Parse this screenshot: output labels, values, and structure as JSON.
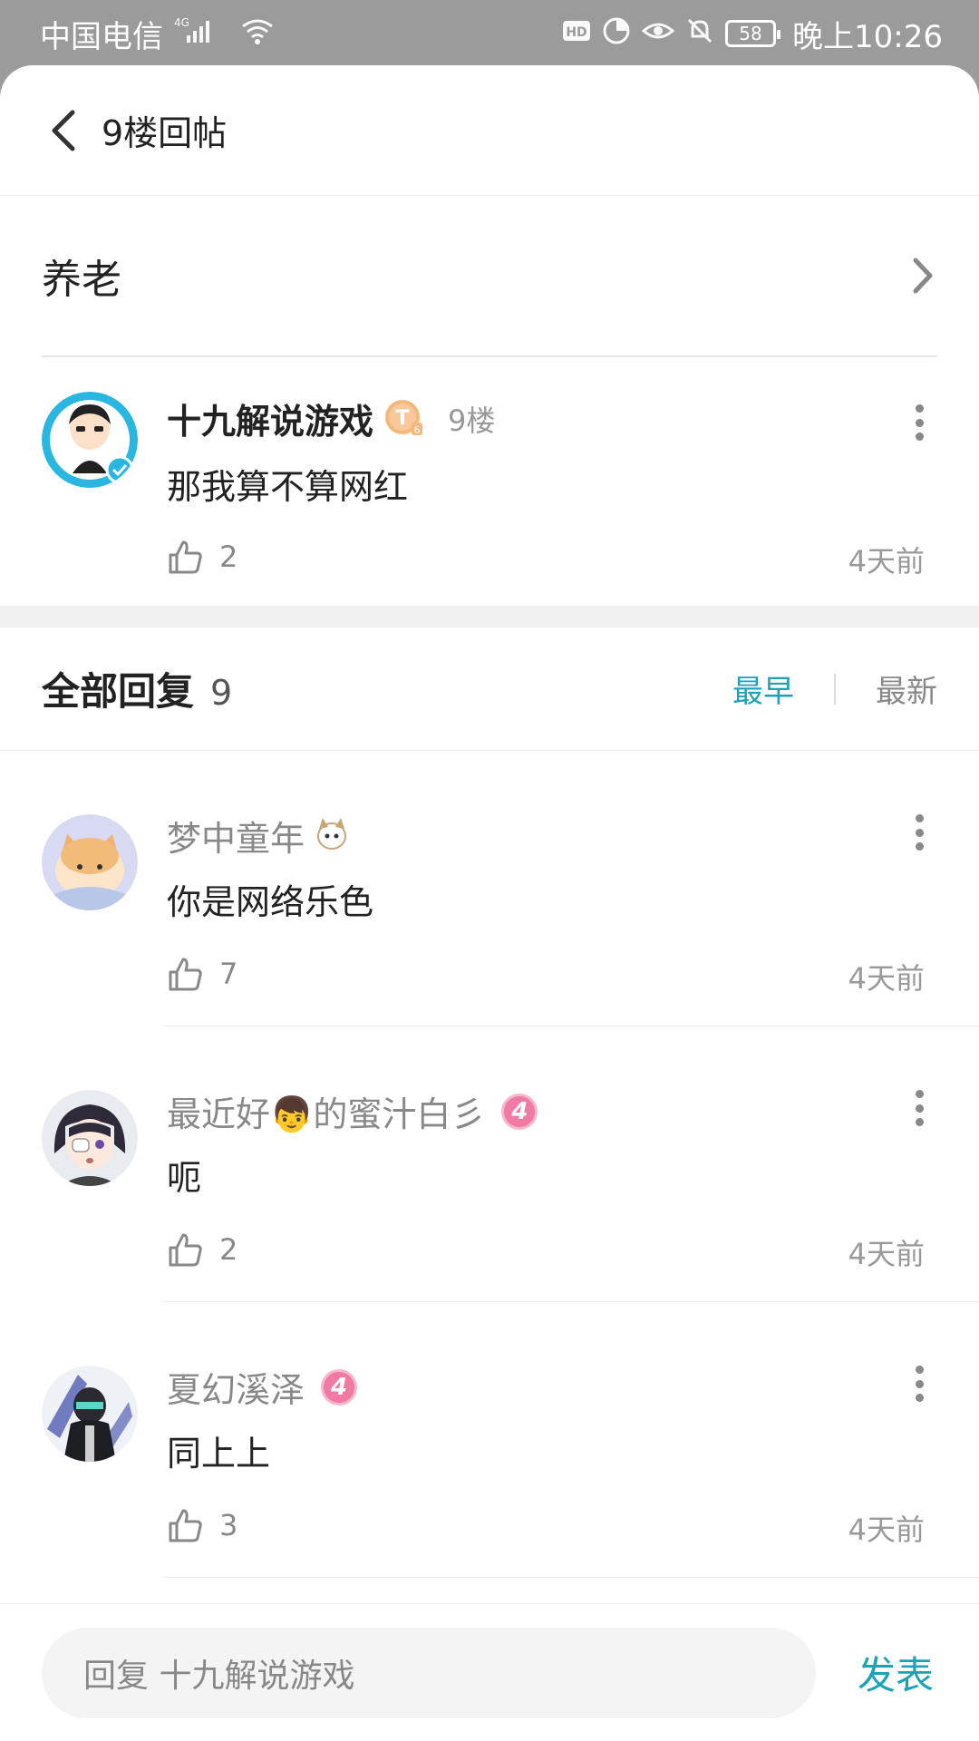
{
  "status_bar": {
    "carrier": "中国电信",
    "network": "4G",
    "battery": "58",
    "time": "晚上10:26"
  },
  "header": {
    "title": "9楼回帖"
  },
  "topic": {
    "title": "养老"
  },
  "main_post": {
    "author": "十九解说游戏",
    "badge": "T",
    "badge_level": "6",
    "floor": "9楼",
    "text": "那我算不算网红",
    "likes": "2",
    "time": "4天前"
  },
  "replies_header": {
    "title": "全部回复",
    "count": "9",
    "sort_earliest": "最早",
    "sort_latest": "最新"
  },
  "replies": [
    {
      "author": "梦中童年",
      "text": "你是网络乐色",
      "likes": "7",
      "time": "4天前",
      "level": ""
    },
    {
      "author_prefix": "最近好",
      "author_emoji": "👦",
      "author_suffix": "的蜜汁白彡",
      "text": "呃",
      "likes": "2",
      "time": "4天前",
      "level": "4"
    },
    {
      "author": "夏幻溪泽",
      "text": "同上上",
      "likes": "3",
      "time": "4天前",
      "level": "4"
    }
  ],
  "reply_box": {
    "placeholder": "回复 十九解说游戏",
    "submit_label": "发表"
  },
  "colors": {
    "accent": "#1aa3b8",
    "status_bar_bg": "#9b9b9b",
    "level_badge": "#f07aa3"
  }
}
